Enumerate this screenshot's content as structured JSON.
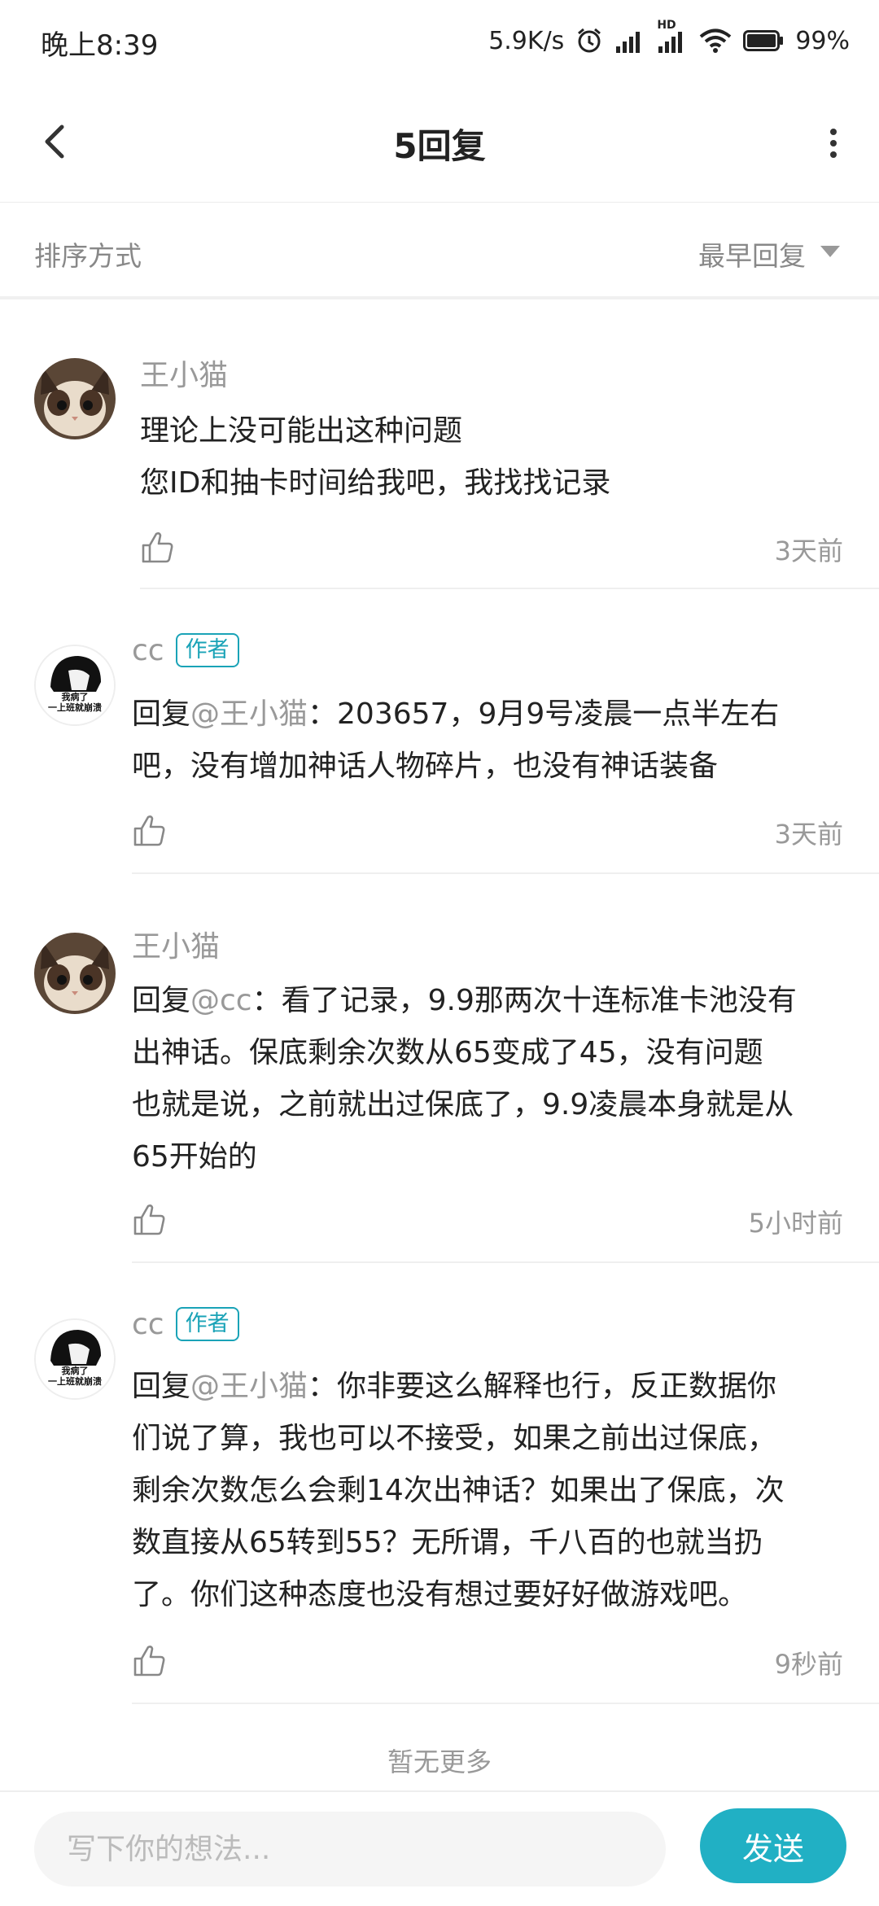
{
  "status_bar": {
    "time": "晚上8:39",
    "net_speed": "5.9K/s",
    "hd_label": "HD",
    "battery": "99%"
  },
  "header": {
    "title": "5回复",
    "back_icon": "chevron-left-icon",
    "more_icon": "more-vertical-icon"
  },
  "sort": {
    "label": "排序方式",
    "value": "最早回复"
  },
  "comments": [
    {
      "name": "王小猫",
      "is_author": false,
      "lines": [
        "理论上没可能出这种问题",
        "您ID和抽卡时间给我吧，我找找记录"
      ],
      "time": "3天前"
    },
    {
      "name": "cc",
      "is_author": true,
      "badge": "作者",
      "reply_prefix": "回复",
      "reply_to": "@王小猫",
      "lines": [
        "：203657，9月9号凌晨一点半左右",
        "吧，没有增加神话人物碎片，也没有神话装备"
      ],
      "avatar_caption": [
        "我病了",
        "一上班就崩溃"
      ],
      "time": "3天前"
    },
    {
      "name": "王小猫",
      "is_author": false,
      "reply_prefix": "回复",
      "reply_to": "@cc",
      "lines": [
        "：看了记录，9.9那两次十连标准卡池没有",
        "出神话。保底剩余次数从65变成了45，没有问题",
        "也就是说，之前就出过保底了，9.9凌晨本身就是从",
        "65开始的"
      ],
      "time": "5小时前"
    },
    {
      "name": "cc",
      "is_author": true,
      "badge": "作者",
      "reply_prefix": "回复",
      "reply_to": "@王小猫",
      "lines": [
        "：你非要这么解释也行，反正数据你",
        "们说了算，我也可以不接受，如果之前出过保底，",
        "剩余次数怎么会剩14次出神话？如果出了保底，次",
        "数直接从65转到55？无所谓，千八百的也就当扔",
        "了。你们这种态度也没有想过要好好做游戏吧。"
      ],
      "avatar_caption": [
        "我病了",
        "一上班就崩溃"
      ],
      "time": "9秒前"
    }
  ],
  "no_more": "暂无更多",
  "composer": {
    "placeholder": "写下你的想法...",
    "send_label": "发送"
  },
  "colors": {
    "accent": "#21b0c4",
    "muted_text": "#999999",
    "badge": "#1aa3b7"
  }
}
